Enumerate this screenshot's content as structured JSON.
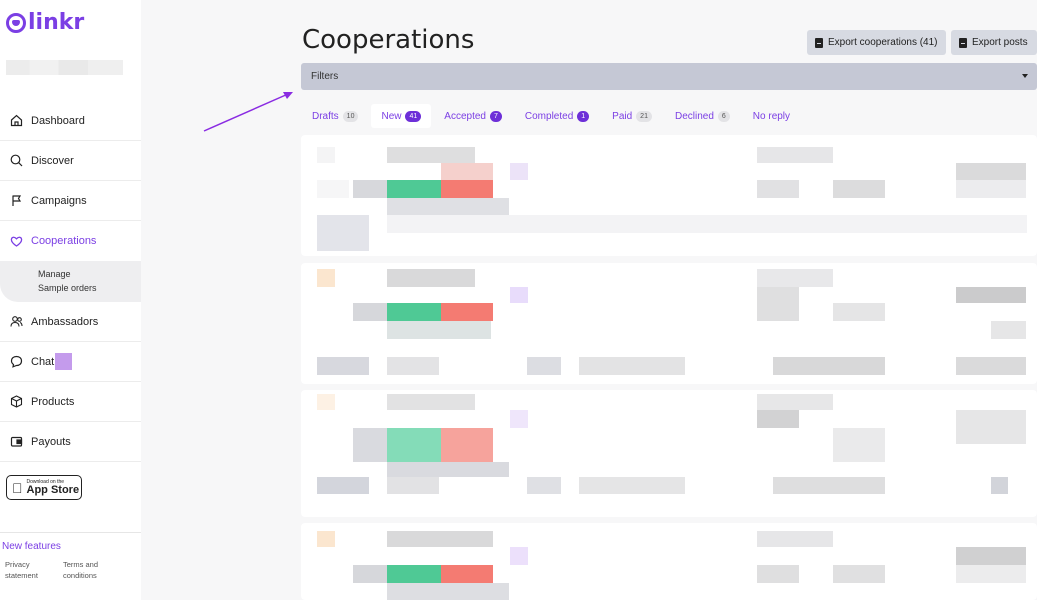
{
  "brand": {
    "name": "linkr",
    "color": "#7b3fe4"
  },
  "sidebar": {
    "nav": [
      {
        "id": "dashboard",
        "label": "Dashboard",
        "icon": "home-icon"
      },
      {
        "id": "discover",
        "label": "Discover",
        "icon": "search-icon"
      },
      {
        "id": "campaigns",
        "label": "Campaigns",
        "icon": "flag-icon"
      },
      {
        "id": "cooperations",
        "label": "Cooperations",
        "icon": "heart-icon",
        "active": true,
        "sub": [
          "Manage",
          "Sample orders"
        ]
      },
      {
        "id": "ambassadors",
        "label": "Ambassadors",
        "icon": "users-icon"
      },
      {
        "id": "chat",
        "label": "Chat",
        "icon": "chat-icon"
      },
      {
        "id": "products",
        "label": "Products",
        "icon": "box-icon"
      },
      {
        "id": "payouts",
        "label": "Payouts",
        "icon": "wallet-icon"
      }
    ],
    "appstore": {
      "small": "Download on the",
      "big": "App Store"
    },
    "new_features": "New features",
    "privacy": "Privacy statement",
    "terms": "Terms and conditions"
  },
  "main": {
    "title": "Cooperations",
    "export_cooperations": "Export cooperations (41)",
    "export_posts": "Export posts",
    "filters_label": "Filters",
    "tabs": [
      {
        "label": "Drafts",
        "count": "10",
        "badge": "grey"
      },
      {
        "label": "New",
        "count": "41",
        "badge": "purple",
        "active": true
      },
      {
        "label": "Accepted",
        "count": "7",
        "badge": "purple"
      },
      {
        "label": "Completed",
        "count": "1",
        "badge": "purple"
      },
      {
        "label": "Paid",
        "count": "21",
        "badge": "grey"
      },
      {
        "label": "Declined",
        "count": "6",
        "badge": "grey"
      },
      {
        "label": "No reply",
        "count": "",
        "badge": ""
      }
    ]
  },
  "colors": {
    "accent": "#7b3fe4",
    "accept": "#4fc995",
    "decline": "#f47b72"
  }
}
